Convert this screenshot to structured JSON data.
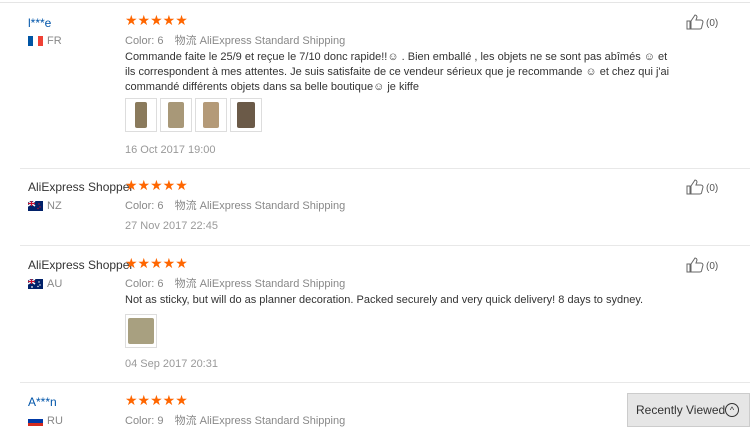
{
  "reviews": [
    {
      "user": "l***e",
      "country": "FR",
      "stars": "★★★★★",
      "color_label": "Color:",
      "color_value": "6",
      "shipping_label": "物流",
      "shipping_value": "AliExpress Standard Shipping",
      "text": "Commande faite le 25/9 et reçue le 7/10 donc rapide!!☺ . Bien emballé , les objets ne se sont pas abîmés ☺ et ils correspondent à mes attentes. Je suis satisfaite de ce vendeur sérieux que je recommande ☺ et chez qui j'ai commandé différents objets dans sa belle boutique☺ je kiffe",
      "date": "16 Oct 2017 19:00",
      "likes": "(0)"
    },
    {
      "user": "AliExpress Shopper",
      "country": "NZ",
      "stars": "★★★★★",
      "color_label": "Color:",
      "color_value": "6",
      "shipping_label": "物流",
      "shipping_value": "AliExpress Standard Shipping",
      "date": "27 Nov 2017 22:45",
      "likes": "(0)"
    },
    {
      "user": "AliExpress Shopper",
      "country": "AU",
      "stars": "★★★★★",
      "color_label": "Color:",
      "color_value": "6",
      "shipping_label": "物流",
      "shipping_value": "AliExpress Standard Shipping",
      "text": "Not as sticky, but will do as planner decoration. Packed securely and very quick delivery! 8 days to sydney.",
      "date": "04 Sep 2017 20:31",
      "likes": "(0)"
    },
    {
      "user": "A***n",
      "country": "RU",
      "stars": "★★★★★",
      "color_label": "Color:",
      "color_value": "9",
      "shipping_label": "物流",
      "shipping_value": "AliExpress Standard Shipping"
    }
  ],
  "recently_viewed": "Recently Viewed",
  "colors": {
    "stars": "#ff6600",
    "user_link": "#0055aa",
    "meta": "#888888"
  },
  "icons": [
    "thumbs-up-icon",
    "flag-icon",
    "chevron-up-icon"
  ]
}
